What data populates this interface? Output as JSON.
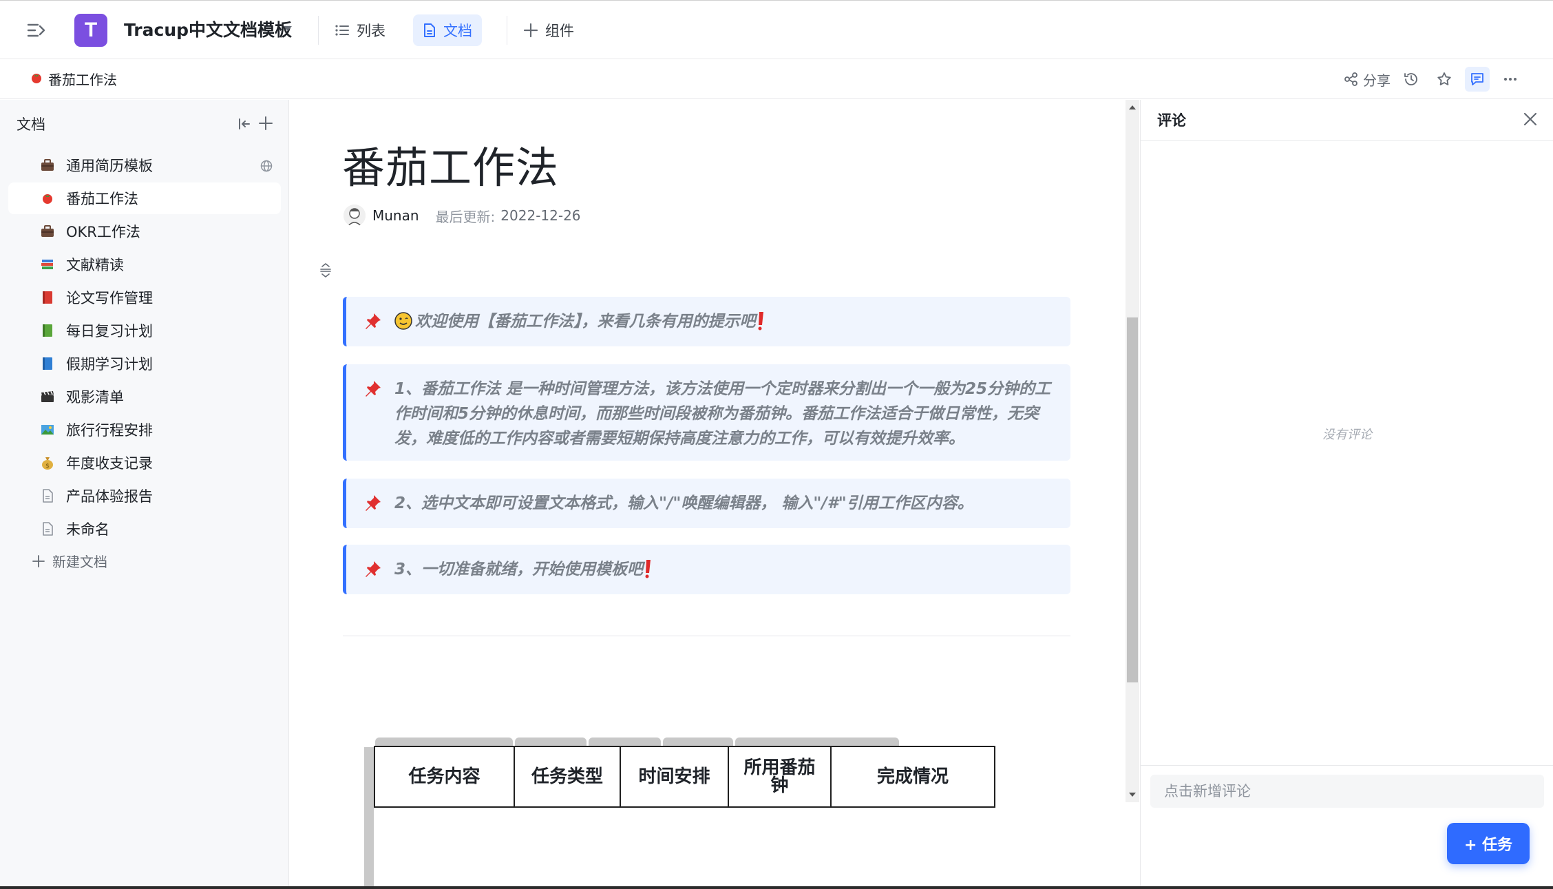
{
  "header": {
    "logo_letter": "T",
    "workspace_title": "Tracup中文文档模板",
    "tabs": [
      {
        "label": "列表",
        "icon": "list-icon",
        "active": false
      },
      {
        "label": "文档",
        "icon": "document-icon",
        "active": true
      },
      {
        "label": "组件",
        "icon": "plus-icon",
        "active": false
      }
    ],
    "accent_color": "#3370ff",
    "logo_color": "#7b4fe0"
  },
  "breadcrumb": {
    "emoji": "tomato-icon",
    "title": "番茄工作法"
  },
  "toolbar": {
    "share_label": "分享",
    "icons": [
      "share-icon",
      "history-icon",
      "star-icon",
      "comment-icon",
      "more-icon"
    ]
  },
  "sidebar": {
    "heading": "文档",
    "items": [
      {
        "label": "通用简历模板",
        "emoji": "briefcase-icon",
        "active": false,
        "public": true
      },
      {
        "label": "番茄工作法",
        "emoji": "tomato-icon",
        "active": true,
        "public": false
      },
      {
        "label": "OKR工作法",
        "emoji": "briefcase-icon",
        "active": false,
        "public": false
      },
      {
        "label": "文献精读",
        "emoji": "books-icon",
        "active": false,
        "public": false
      },
      {
        "label": "论文写作管理",
        "emoji": "red-book-icon",
        "active": false,
        "public": false
      },
      {
        "label": "每日复习计划",
        "emoji": "green-book-icon",
        "active": false,
        "public": false
      },
      {
        "label": "假期学习计划",
        "emoji": "blue-book-icon",
        "active": false,
        "public": false
      },
      {
        "label": "观影清单",
        "emoji": "clapper-icon",
        "active": false,
        "public": false
      },
      {
        "label": "旅行行程安排",
        "emoji": "landscape-icon",
        "active": false,
        "public": false
      },
      {
        "label": "年度收支记录",
        "emoji": "money-bag-icon",
        "active": false,
        "public": false
      },
      {
        "label": "产品体验报告",
        "emoji": "page-icon",
        "active": false,
        "public": false
      },
      {
        "label": "未命名",
        "emoji": "page-icon",
        "active": false,
        "public": false
      }
    ],
    "new_doc_label": "新建文档"
  },
  "document": {
    "title": "番茄工作法",
    "author": "Munan",
    "updated_label": "最后更新:",
    "updated_date": "2022-12-26",
    "callouts": [
      {
        "text": "欢迎使用【番茄工作法】，来看几条有用的提示吧"
      },
      {
        "text": "1、番茄工作法 是一种时间管理方法，该方法使用一个定时器来分割出一个一般为25分钟的工作时间和5分钟的休息时间，而那些时间段被称为番茄钟。番茄工作法适合于做日常性，无突发，难度低的工作内容或者需要短期保持高度注意力的工作，可以有效提升效率。"
      },
      {
        "text": "2、选中文本即可设置文本格式，输入\"/\"唤醒编辑器， 输入\"/#\"引用工作区内容。"
      },
      {
        "text": "3、一切准备就绪，开始使用模板吧"
      }
    ],
    "table_headers": [
      "任务内容",
      "任务类型",
      "时间安排",
      "所用番茄钟",
      "完成情况"
    ]
  },
  "comments": {
    "title": "评论",
    "empty_text": "没有评论",
    "input_placeholder": "点击新增评论",
    "task_button_label": "+ 任务"
  }
}
